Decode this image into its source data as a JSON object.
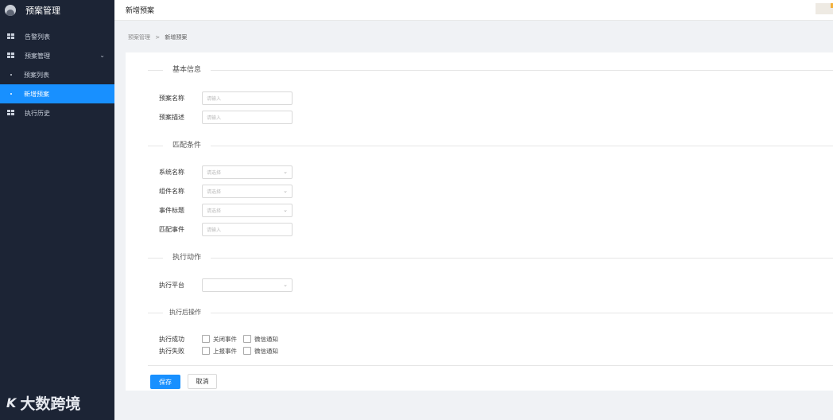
{
  "sidebar": {
    "app_title": "预案管理",
    "items": [
      {
        "label": "告警列表",
        "icon": "grid-icon"
      },
      {
        "label": "预案管理",
        "icon": "grid-icon",
        "expanded": true,
        "children": [
          {
            "label": "预案列表",
            "active": false
          },
          {
            "label": "新增预案",
            "active": true
          }
        ]
      },
      {
        "label": "执行历史",
        "icon": "grid-icon"
      }
    ],
    "chevron": "⌄",
    "brand_mark": "K",
    "brand_name": "大数跨境"
  },
  "header": {
    "title": "新增预案"
  },
  "breadcrumb": {
    "root": "预案管理",
    "separator": ">",
    "current": "新增预案"
  },
  "form": {
    "sections": {
      "basic": "基本信息",
      "match": "匹配条件",
      "action": "执行动作",
      "after": "执行后操作"
    },
    "fields": {
      "plan_name": {
        "label": "预案名称",
        "placeholder": "请输入"
      },
      "plan_desc": {
        "label": "预案描述",
        "placeholder": "请输入"
      },
      "system_name": {
        "label": "系统名称",
        "placeholder": "请选择"
      },
      "component_name": {
        "label": "组件名称",
        "placeholder": "请选择"
      },
      "event_title": {
        "label": "事件标题",
        "placeholder": "请选择"
      },
      "match_event": {
        "label": "匹配事件",
        "placeholder": "请输入"
      },
      "exec_platform": {
        "label": "执行平台",
        "placeholder": ""
      }
    },
    "after_ops": {
      "success": {
        "label": "执行成功",
        "options": [
          "关闭事件",
          "微信通知"
        ]
      },
      "failure": {
        "label": "执行失败",
        "options": [
          "上报事件",
          "微信通知"
        ]
      }
    },
    "buttons": {
      "save": "保存",
      "cancel": "取消"
    }
  },
  "colors": {
    "sidebar_bg": "#1c2435",
    "accent": "#1890ff"
  }
}
